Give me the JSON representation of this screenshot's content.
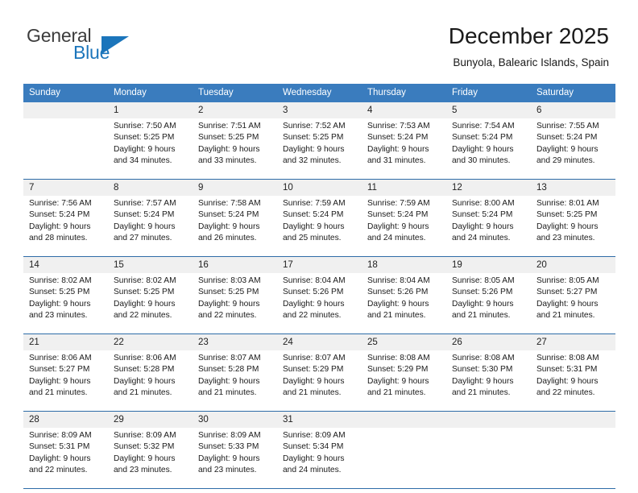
{
  "brand": {
    "name_part1": "General",
    "name_part2": "Blue",
    "accent_color": "#1b75bb"
  },
  "header": {
    "title": "December 2025",
    "location": "Bunyola, Balearic Islands, Spain"
  },
  "calendar": {
    "header_bg": "#3a7cbe",
    "daynum_bg": "#f0f0f0",
    "rule_color": "#2e6ca8",
    "weekdays": [
      "Sunday",
      "Monday",
      "Tuesday",
      "Wednesday",
      "Thursday",
      "Friday",
      "Saturday"
    ],
    "weeks": [
      [
        {
          "day": "",
          "lines": []
        },
        {
          "day": "1",
          "lines": [
            "Sunrise: 7:50 AM",
            "Sunset: 5:25 PM",
            "Daylight: 9 hours",
            "and 34 minutes."
          ]
        },
        {
          "day": "2",
          "lines": [
            "Sunrise: 7:51 AM",
            "Sunset: 5:25 PM",
            "Daylight: 9 hours",
            "and 33 minutes."
          ]
        },
        {
          "day": "3",
          "lines": [
            "Sunrise: 7:52 AM",
            "Sunset: 5:25 PM",
            "Daylight: 9 hours",
            "and 32 minutes."
          ]
        },
        {
          "day": "4",
          "lines": [
            "Sunrise: 7:53 AM",
            "Sunset: 5:24 PM",
            "Daylight: 9 hours",
            "and 31 minutes."
          ]
        },
        {
          "day": "5",
          "lines": [
            "Sunrise: 7:54 AM",
            "Sunset: 5:24 PM",
            "Daylight: 9 hours",
            "and 30 minutes."
          ]
        },
        {
          "day": "6",
          "lines": [
            "Sunrise: 7:55 AM",
            "Sunset: 5:24 PM",
            "Daylight: 9 hours",
            "and 29 minutes."
          ]
        }
      ],
      [
        {
          "day": "7",
          "lines": [
            "Sunrise: 7:56 AM",
            "Sunset: 5:24 PM",
            "Daylight: 9 hours",
            "and 28 minutes."
          ]
        },
        {
          "day": "8",
          "lines": [
            "Sunrise: 7:57 AM",
            "Sunset: 5:24 PM",
            "Daylight: 9 hours",
            "and 27 minutes."
          ]
        },
        {
          "day": "9",
          "lines": [
            "Sunrise: 7:58 AM",
            "Sunset: 5:24 PM",
            "Daylight: 9 hours",
            "and 26 minutes."
          ]
        },
        {
          "day": "10",
          "lines": [
            "Sunrise: 7:59 AM",
            "Sunset: 5:24 PM",
            "Daylight: 9 hours",
            "and 25 minutes."
          ]
        },
        {
          "day": "11",
          "lines": [
            "Sunrise: 7:59 AM",
            "Sunset: 5:24 PM",
            "Daylight: 9 hours",
            "and 24 minutes."
          ]
        },
        {
          "day": "12",
          "lines": [
            "Sunrise: 8:00 AM",
            "Sunset: 5:24 PM",
            "Daylight: 9 hours",
            "and 24 minutes."
          ]
        },
        {
          "day": "13",
          "lines": [
            "Sunrise: 8:01 AM",
            "Sunset: 5:25 PM",
            "Daylight: 9 hours",
            "and 23 minutes."
          ]
        }
      ],
      [
        {
          "day": "14",
          "lines": [
            "Sunrise: 8:02 AM",
            "Sunset: 5:25 PM",
            "Daylight: 9 hours",
            "and 23 minutes."
          ]
        },
        {
          "day": "15",
          "lines": [
            "Sunrise: 8:02 AM",
            "Sunset: 5:25 PM",
            "Daylight: 9 hours",
            "and 22 minutes."
          ]
        },
        {
          "day": "16",
          "lines": [
            "Sunrise: 8:03 AM",
            "Sunset: 5:25 PM",
            "Daylight: 9 hours",
            "and 22 minutes."
          ]
        },
        {
          "day": "17",
          "lines": [
            "Sunrise: 8:04 AM",
            "Sunset: 5:26 PM",
            "Daylight: 9 hours",
            "and 22 minutes."
          ]
        },
        {
          "day": "18",
          "lines": [
            "Sunrise: 8:04 AM",
            "Sunset: 5:26 PM",
            "Daylight: 9 hours",
            "and 21 minutes."
          ]
        },
        {
          "day": "19",
          "lines": [
            "Sunrise: 8:05 AM",
            "Sunset: 5:26 PM",
            "Daylight: 9 hours",
            "and 21 minutes."
          ]
        },
        {
          "day": "20",
          "lines": [
            "Sunrise: 8:05 AM",
            "Sunset: 5:27 PM",
            "Daylight: 9 hours",
            "and 21 minutes."
          ]
        }
      ],
      [
        {
          "day": "21",
          "lines": [
            "Sunrise: 8:06 AM",
            "Sunset: 5:27 PM",
            "Daylight: 9 hours",
            "and 21 minutes."
          ]
        },
        {
          "day": "22",
          "lines": [
            "Sunrise: 8:06 AM",
            "Sunset: 5:28 PM",
            "Daylight: 9 hours",
            "and 21 minutes."
          ]
        },
        {
          "day": "23",
          "lines": [
            "Sunrise: 8:07 AM",
            "Sunset: 5:28 PM",
            "Daylight: 9 hours",
            "and 21 minutes."
          ]
        },
        {
          "day": "24",
          "lines": [
            "Sunrise: 8:07 AM",
            "Sunset: 5:29 PM",
            "Daylight: 9 hours",
            "and 21 minutes."
          ]
        },
        {
          "day": "25",
          "lines": [
            "Sunrise: 8:08 AM",
            "Sunset: 5:29 PM",
            "Daylight: 9 hours",
            "and 21 minutes."
          ]
        },
        {
          "day": "26",
          "lines": [
            "Sunrise: 8:08 AM",
            "Sunset: 5:30 PM",
            "Daylight: 9 hours",
            "and 21 minutes."
          ]
        },
        {
          "day": "27",
          "lines": [
            "Sunrise: 8:08 AM",
            "Sunset: 5:31 PM",
            "Daylight: 9 hours",
            "and 22 minutes."
          ]
        }
      ],
      [
        {
          "day": "28",
          "lines": [
            "Sunrise: 8:09 AM",
            "Sunset: 5:31 PM",
            "Daylight: 9 hours",
            "and 22 minutes."
          ]
        },
        {
          "day": "29",
          "lines": [
            "Sunrise: 8:09 AM",
            "Sunset: 5:32 PM",
            "Daylight: 9 hours",
            "and 23 minutes."
          ]
        },
        {
          "day": "30",
          "lines": [
            "Sunrise: 8:09 AM",
            "Sunset: 5:33 PM",
            "Daylight: 9 hours",
            "and 23 minutes."
          ]
        },
        {
          "day": "31",
          "lines": [
            "Sunrise: 8:09 AM",
            "Sunset: 5:34 PM",
            "Daylight: 9 hours",
            "and 24 minutes."
          ]
        },
        {
          "day": "",
          "lines": []
        },
        {
          "day": "",
          "lines": []
        },
        {
          "day": "",
          "lines": []
        }
      ]
    ]
  }
}
